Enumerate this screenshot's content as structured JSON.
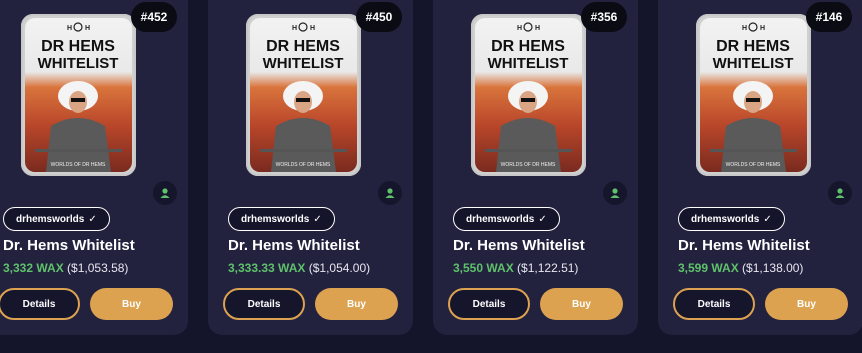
{
  "theme": {
    "background": "#14142a",
    "card": "#22223f",
    "accent": "#dca250",
    "wax_green": "#5fc16a"
  },
  "cards": [
    {
      "number": "#452",
      "collection": "drhemsworlds",
      "name": "Dr. Hems Whitelist",
      "price_wax": "3,332 WAX",
      "price_usd": "($1,053.58)",
      "details_label": "Details",
      "buy_label": "Buy",
      "image": {
        "title_line1": "DR HEMS",
        "title_line2": "WHITELIST",
        "footer": "WORLDS OF DR HEMS"
      }
    },
    {
      "number": "#450",
      "collection": "drhemsworlds",
      "name": "Dr. Hems Whitelist",
      "price_wax": "3,333.33 WAX",
      "price_usd": "($1,054.00)",
      "details_label": "Details",
      "buy_label": "Buy",
      "image": {
        "title_line1": "DR HEMS",
        "title_line2": "WHITELIST",
        "footer": "WORLDS OF DR HEMS"
      }
    },
    {
      "number": "#356",
      "collection": "drhemsworlds",
      "name": "Dr. Hems Whitelist",
      "price_wax": "3,550 WAX",
      "price_usd": "($1,122.51)",
      "details_label": "Details",
      "buy_label": "Buy",
      "image": {
        "title_line1": "DR HEMS",
        "title_line2": "WHITELIST",
        "footer": "WORLDS OF DR HEMS"
      }
    },
    {
      "number": "#146",
      "collection": "drhemsworlds",
      "name": "Dr. Hems Whitelist",
      "price_wax": "3,599 WAX",
      "price_usd": "($1,138.00)",
      "details_label": "Details",
      "buy_label": "Buy",
      "image": {
        "title_line1": "DR HEMS",
        "title_line2": "WHITELIST",
        "footer": "WORLDS OF DR HEMS"
      }
    }
  ]
}
